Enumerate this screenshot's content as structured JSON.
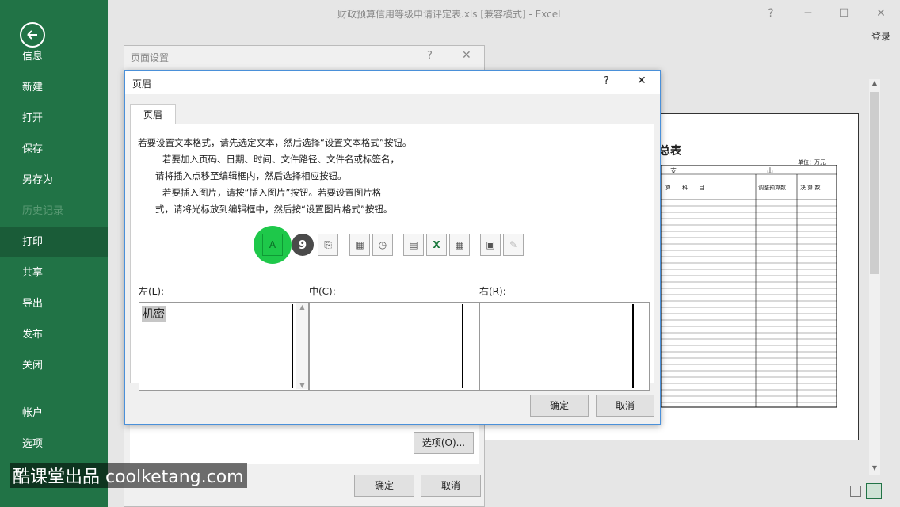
{
  "window": {
    "title": "财政预算信用等级申请评定表.xls  [兼容模式] - Excel",
    "help": "?",
    "minimize": "─",
    "restore": "☐",
    "close": "✕",
    "login": "登录"
  },
  "nav": {
    "items": [
      {
        "label": "信息"
      },
      {
        "label": "新建"
      },
      {
        "label": "打开"
      },
      {
        "label": "保存"
      },
      {
        "label": "另存为"
      },
      {
        "label": "历史记录"
      },
      {
        "label": "打印"
      },
      {
        "label": "共享"
      },
      {
        "label": "导出"
      },
      {
        "label": "发布"
      },
      {
        "label": "关闭"
      },
      {
        "label": "帐户"
      },
      {
        "label": "选项"
      }
    ]
  },
  "page_setup": {
    "title": "页面设置",
    "help": "?",
    "close": "✕",
    "options_button": "选项(O)...",
    "ok": "确定",
    "cancel": "取消"
  },
  "header_dialog": {
    "title": "页眉",
    "help": "?",
    "close": "✕",
    "tab": "页眉",
    "instructions": [
      "若要设置文本格式，请先选定文本，然后选择“设置文本格式”按钮。",
      "若要加入页码、日期、时间、文件路径、文件名或标签名，",
      "请将插入点移至编辑框内，然后选择相应按钮。",
      "若要插入图片，请按“插入图片”按钮。若要设置图片格",
      "式，请将光标放到编辑框中，然后按“设置图片格式”按钮。"
    ],
    "toolbar_badge": "9",
    "left_label": "左(L):",
    "center_label": "中(C):",
    "right_label": "右(R):",
    "left_value": "机密",
    "ok": "确定",
    "cancel": "取消"
  },
  "preview": {
    "title_fragment": "总表",
    "unit": "单位：万元",
    "col_header_1": "支",
    "col_header_2": "出",
    "col_subject": "算　　科　　目",
    "col_budget": "调整预算数",
    "col_final": "决 算 数"
  },
  "watermark": "酷课堂出品 coolketang.com",
  "colors": {
    "accent": "#217346",
    "highlight": "#1ec84a",
    "dialog_border": "#4a90d9"
  }
}
